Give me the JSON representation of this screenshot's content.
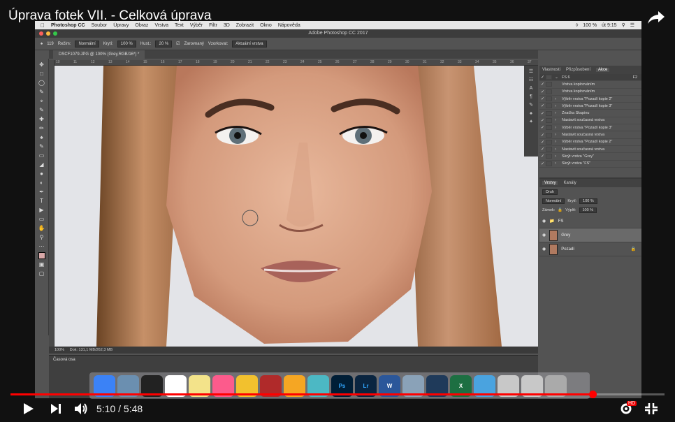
{
  "video": {
    "title": "Úprava fotek VII. - Celková úprava",
    "current_time": "5:10",
    "separator": "/",
    "duration": "5:48",
    "progress": 0.89,
    "hd_badge": "HD"
  },
  "menubar": {
    "app": "Photoshop CC",
    "items": [
      "Soubor",
      "Úpravy",
      "Obraz",
      "Vrstva",
      "Text",
      "Výběr",
      "Filtr",
      "3D",
      "Zobrazit",
      "Okno",
      "Nápověda"
    ],
    "battery": "100 %",
    "clock": "út 9:15"
  },
  "window_title": "Adobe Photoshop CC 2017",
  "options": {
    "brush_size": "119",
    "mode_label": "Režim:",
    "mode_value": "Normální",
    "opacity_label": "Krytí:",
    "opacity_value": "100 %",
    "flow_label": "Hust.:",
    "flow_value": "20 %",
    "aligned_label": "Zarovnaný",
    "sample_label": "Vzorkovat:",
    "sample_value": "Aktuální vrstva"
  },
  "document_tab": "DSCF1079.JPG @ 100% (Grey,RGB/16*) *",
  "ruler_ticks": [
    "10",
    "11",
    "12",
    "13",
    "14",
    "15",
    "16",
    "17",
    "18",
    "19",
    "20",
    "21",
    "22",
    "23",
    "24",
    "25",
    "26",
    "27",
    "28",
    "29",
    "30",
    "31",
    "32",
    "33",
    "34",
    "35",
    "36",
    "37"
  ],
  "status": {
    "zoom": "100%",
    "doc": "Dok: 131,1 MB/262,3 MB"
  },
  "timeline_title": "Časová osa",
  "panels_top": {
    "tabs": [
      "Vlastnosti",
      "Přizpůsobení",
      "Akce"
    ],
    "actions": [
      {
        "label": "FS 6",
        "shortcut": "F2",
        "folder": true
      },
      {
        "label": "Vrstva kopírováním"
      },
      {
        "label": "Vrstva kopírováním"
      },
      {
        "label": "Výběr vrstva \"Pozadí kopie 2\""
      },
      {
        "label": "Výběr vrstva \"Pozadí kopie 3\""
      },
      {
        "label": "Značka Skupinu"
      },
      {
        "label": "Nastavit současná vrstva"
      },
      {
        "label": "Výběr vrstva \"Pozadí kopie 3\""
      },
      {
        "label": "Nastavit současná vrstva"
      },
      {
        "label": "Výběr vrstva \"Pozadí kopie 2\""
      },
      {
        "label": "Nastavit současná vrstva"
      },
      {
        "label": "Skrýt vrstva \"Grey\""
      },
      {
        "label": "Skrýt vrstva \"FS\""
      }
    ]
  },
  "layers": {
    "tabs": [
      "Vrstvy",
      "Kanály"
    ],
    "filter": "Druh",
    "blend": "Normální",
    "opacity_label": "Krytí:",
    "opacity": "100 %",
    "lock_label": "Zámek:",
    "fill_label": "Výplň:",
    "fill": "100 %",
    "items": [
      {
        "name": "FS",
        "type": "group"
      },
      {
        "name": "Grey",
        "type": "layer",
        "selected": true
      },
      {
        "name": "Pozadí",
        "type": "background"
      }
    ]
  },
  "dock_apps": [
    "Finder",
    "Preview",
    "Dashboard",
    "Calendar",
    "Notes",
    "iTunes",
    "Chrome",
    "Photo Booth",
    "Photos",
    "Lightroom Classic",
    "Ps",
    "Lr",
    "W",
    "Image Capture",
    "QuickTime",
    "X",
    "Folder",
    "Documents",
    "Documents 2",
    "Trash"
  ],
  "colors": {
    "ps_dark": "#535353",
    "progress_red": "#ff0000"
  }
}
